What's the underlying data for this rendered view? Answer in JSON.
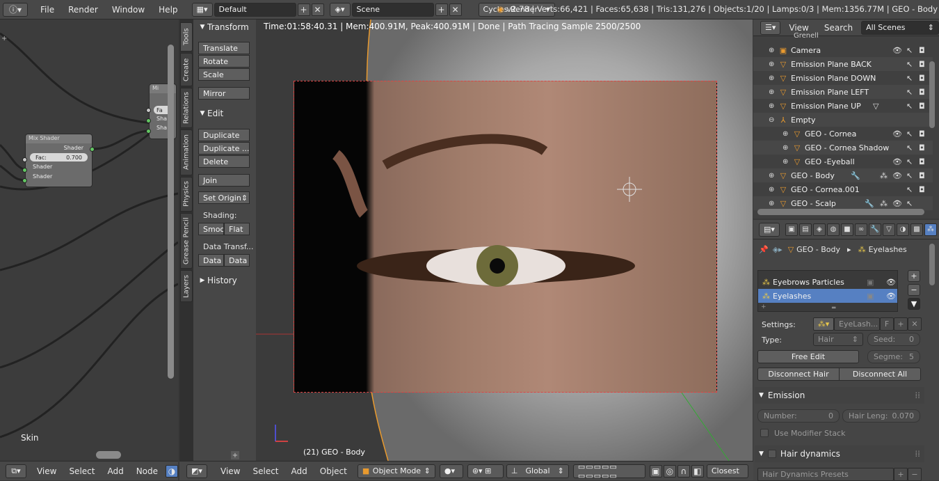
{
  "topbar": {
    "menu": [
      "File",
      "Render",
      "Window",
      "Help"
    ],
    "layout": "Default",
    "scene": "Scene",
    "engine": "Cycles Render",
    "stats": "v2.78 | Verts:66,421 | Faces:65,638 | Tris:131,276 | Objects:1/20 | Lamps:0/3 | Mem:1356.77M | GEO - Body"
  },
  "node_editor": {
    "node_mix": {
      "title": "Mix Shader",
      "output": "Shader",
      "fac_label": "Fac:",
      "fac_value": "0.700",
      "input1": "Shader",
      "input2": "Shader"
    },
    "node_right": {
      "title": "Mi",
      "fac": "Fa",
      "s1": "Sha",
      "s2": "Sha"
    },
    "material_label": "Skin",
    "bottom_menu": [
      "View",
      "Select",
      "Add",
      "Node"
    ]
  },
  "tabs": [
    "Tools",
    "Create",
    "Relations",
    "Animation",
    "Physics",
    "Grease Pencil",
    "Layers"
  ],
  "toolshelf": {
    "transform_header": "Transform",
    "translate": "Translate",
    "rotate": "Rotate",
    "scale": "Scale",
    "mirror": "Mirror",
    "edit_header": "Edit",
    "duplicate": "Duplicate",
    "duplicate_linked": "Duplicate ...",
    "delete": "Delete",
    "join": "Join",
    "set_origin": "Set Origin",
    "shading_label": "Shading:",
    "smooth": "Smoo",
    "flat": "Flat",
    "data_transfer_label": "Data Transf...",
    "data1": "Data",
    "data2": "Data",
    "history_header": "History"
  },
  "viewport": {
    "info": "Time:01:58:40.31 | Mem:400.91M, Peak:400.91M | Done | Path Tracing Sample 2500/2500",
    "object_label": "(21) GEO - Body",
    "bottom_menu": [
      "View",
      "Select",
      "Add",
      "Object"
    ],
    "mode": "Object Mode",
    "orientation": "Global",
    "snap": "Closest"
  },
  "outliner": {
    "menu": [
      "View",
      "Search"
    ],
    "filter": "All Scenes",
    "partial_top": "Grenell",
    "rows": [
      "Camera",
      "Emission Plane BACK",
      "Emission Plane DOWN",
      "Emission Plane LEFT",
      "Emission Plane UP",
      "Empty",
      "GEO - Cornea",
      "GEO - Cornea Shadow",
      "GEO -Eyeball",
      "GEO - Body",
      "GEO - Cornea.001",
      "GEO - Scalp"
    ]
  },
  "properties": {
    "breadcrumb_obj": "GEO - Body",
    "breadcrumb_sys": "Eyelashes",
    "particles": [
      "Eyebrows Particles",
      "Eyelashes"
    ],
    "settings_label": "Settings:",
    "settings_value": "EyeLash...",
    "settings_f": "F",
    "type_label": "Type:",
    "type_value": "Hair",
    "seed_label": "Seed:",
    "seed_value": "0",
    "free_edit": "Free Edit",
    "segments_label": "Segme:",
    "segments_value": "5",
    "disconnect_hair": "Disconnect Hair",
    "disconnect_all": "Disconnect All",
    "emission_header": "Emission",
    "number_label": "Number:",
    "number_value": "0",
    "hair_length_label": "Hair Leng:",
    "hair_length_value": "0.070",
    "use_modifier_stack": "Use Modifier Stack",
    "hair_dynamics_header": "Hair dynamics",
    "hair_dynamics_presets": "Hair Dynamics Presets"
  }
}
